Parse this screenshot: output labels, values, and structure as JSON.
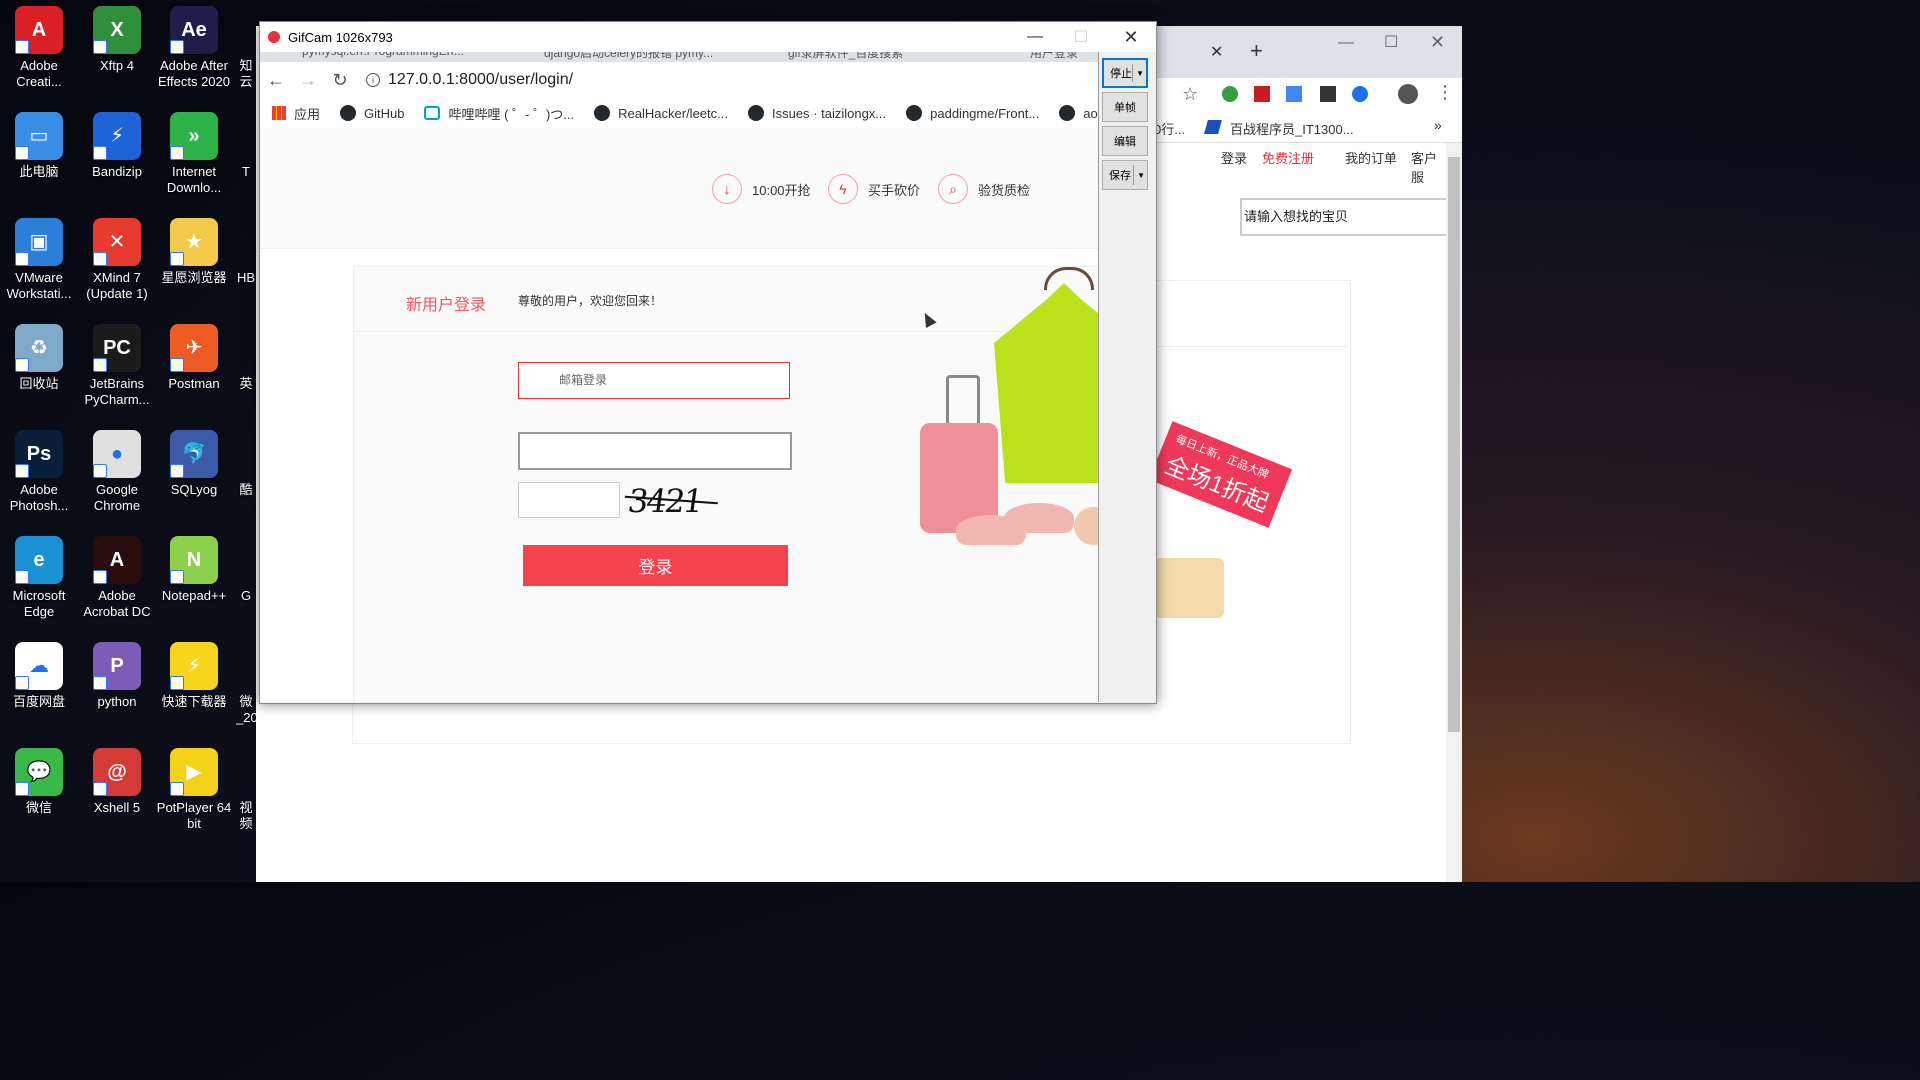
{
  "desktop": {
    "icons": [
      {
        "label": "Adobe Creati...",
        "color": "#da1f26",
        "glyph": "A"
      },
      {
        "label": "Xftp 4",
        "color": "#2f8f3a",
        "glyph": "X"
      },
      {
        "label": "Adobe After Effects 2020",
        "color": "#1f1d4a",
        "glyph": "Ae"
      },
      {
        "label": "此电脑",
        "color": "#3a8ee6",
        "glyph": "▭"
      },
      {
        "label": "Bandizip",
        "color": "#1e64d8",
        "glyph": "⚡"
      },
      {
        "label": "Internet Downlo...",
        "color": "#2db34a",
        "glyph": "»"
      },
      {
        "label": "VMware Workstati...",
        "color": "#2b7fd8",
        "glyph": "▣"
      },
      {
        "label": "XMind 7 (Update 1)",
        "color": "#e43b2e",
        "glyph": "✕"
      },
      {
        "label": "星愿浏览器",
        "color": "#f3c94c",
        "glyph": "★"
      },
      {
        "label": "回收站",
        "color": "#7fa9c9",
        "glyph": "♻"
      },
      {
        "label": "JetBrains PyCharm...",
        "color": "#1b1b1b",
        "glyph": "PC"
      },
      {
        "label": "Postman",
        "color": "#ef5b25",
        "glyph": "✈"
      },
      {
        "label": "Adobe Photosh...",
        "color": "#0a1f3a",
        "glyph": "Ps"
      },
      {
        "label": "Google Chrome",
        "color": "#e0e0e0",
        "glyph": "●"
      },
      {
        "label": "SQLyog",
        "color": "#3b5ba8",
        "glyph": "🐬"
      },
      {
        "label": "Microsoft Edge",
        "color": "#1b8fd4",
        "glyph": "e"
      },
      {
        "label": "Adobe Acrobat DC",
        "color": "#2a0d0d",
        "glyph": "A"
      },
      {
        "label": "Notepad++",
        "color": "#8ccf4b",
        "glyph": "N"
      },
      {
        "label": "百度网盘",
        "color": "#ffffff",
        "glyph": "☁"
      },
      {
        "label": "python",
        "color": "#7d5cb8",
        "glyph": "P"
      },
      {
        "label": "快速下载器",
        "color": "#f7d51c",
        "glyph": "⚡"
      },
      {
        "label": "微信",
        "color": "#3bb84a",
        "glyph": "💬"
      },
      {
        "label": "Xshell 5",
        "color": "#d43b36",
        "glyph": "@"
      },
      {
        "label": "PotPlayer 64 bit",
        "color": "#f5d21a",
        "glyph": "▶"
      }
    ],
    "partial_labels": [
      "知云",
      "T",
      "HB",
      "英",
      "酷",
      "G",
      "微_20",
      "视频"
    ]
  },
  "back_browser": {
    "bookmarks_partial": [
      "0行...",
      "百战程序员_IT1300..."
    ],
    "nav": {
      "login": "登录",
      "register": "免费注册",
      "orders": "我的订单",
      "service": "客户服"
    },
    "search_placeholder": "请输入想找的宝贝",
    "banner": "每日上新，正品大牌",
    "banner_big": "全场1折起"
  },
  "gifcam": {
    "title": "GifCam 1026x793",
    "buttons": {
      "stop": "停止",
      "frame": "单帧",
      "edit": "编辑",
      "save": "保存"
    }
  },
  "browser": {
    "tabs": [
      "pymysql.err.ProgrammingErr...",
      "django启动celery的报错 pymy...",
      "gif录屏软件_百度搜索",
      "用户登录"
    ],
    "url": "127.0.0.1:8000/user/login/",
    "bookmarks": [
      "应用",
      "GitHub",
      "哔哩哔哩 ( ゜- ゜)つ...",
      "RealHacker/leetc...",
      "Issues · taizilongx...",
      "paddingme/Front...",
      "aosa"
    ]
  },
  "page": {
    "promos": [
      {
        "text": "10:00开抢",
        "icon": "clock-icon"
      },
      {
        "text": "买手砍价",
        "icon": "bolt-icon"
      },
      {
        "text": "验货质检",
        "icon": "magnifier-icon"
      }
    ],
    "login_title": "新用户登录",
    "login_welcome": "尊敬的用户，欢迎您回来！",
    "email_placeholder": "邮箱登录",
    "captcha": "3421",
    "login_button": "登录"
  }
}
